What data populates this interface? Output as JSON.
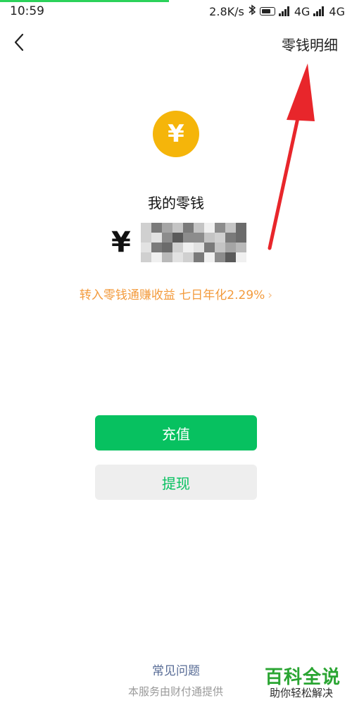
{
  "status_bar": {
    "time": "10:59",
    "network_speed": "2.8K/s",
    "sim1_type": "4G",
    "sim2_type": "4G",
    "bluetooth_icon": "bluetooth-icon",
    "battery_icon": "battery-icon"
  },
  "nav": {
    "back_icon": "chevron-left-icon",
    "detail_link": "零钱明细"
  },
  "wallet": {
    "coin_symbol": "¥",
    "balance_label": "我的零钱",
    "currency_symbol": "¥",
    "balance_value_pixelated": true
  },
  "promo": {
    "text": "转入零钱通赚收益 七日年化2.29%",
    "chevron": "›"
  },
  "actions": {
    "recharge_label": "充值",
    "withdraw_label": "提现"
  },
  "footer": {
    "faq_label": "常见问题",
    "provider_note": "本服务由财付通提供"
  },
  "watermark": {
    "title": "百科全说",
    "subtitle": "助你轻松解决"
  },
  "colors": {
    "primary_green": "#07c160",
    "coin_yellow": "#f5b50a",
    "promo_orange": "#f39b3d",
    "link_blue": "#576b95",
    "annotation_red": "#e8262b"
  }
}
